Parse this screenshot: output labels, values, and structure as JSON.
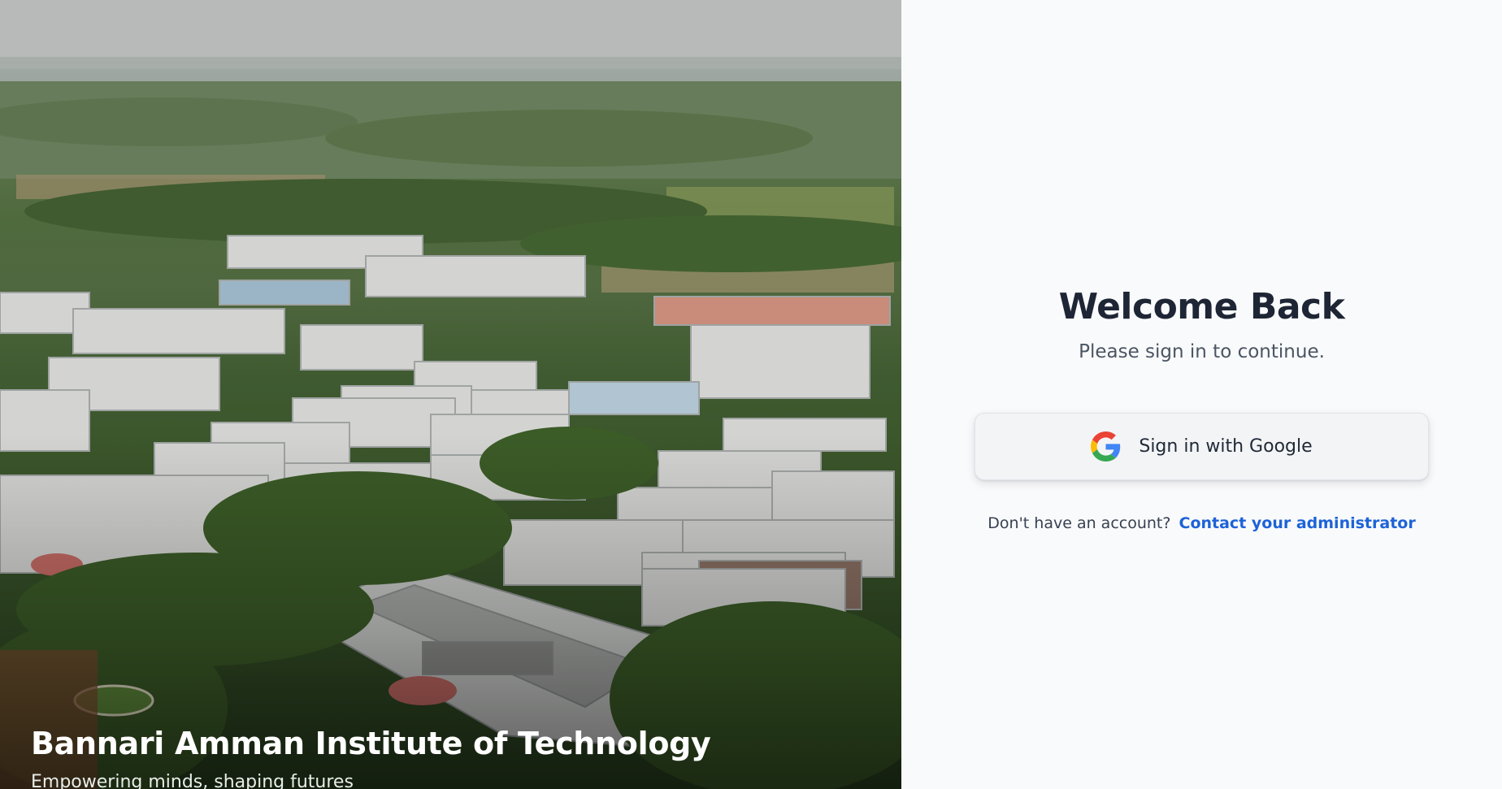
{
  "hero": {
    "title": "Bannari Amman Institute of Technology",
    "subtitle": "Empowering minds, shaping futures"
  },
  "login": {
    "heading": "Welcome Back",
    "subheading": "Please sign in to continue.",
    "google_button_label": "Sign in with Google",
    "google_icon": "google-g-icon",
    "no_account_text": "Don't have an account?",
    "contact_link_text": "Contact your administrator"
  },
  "colors": {
    "heading": "#1e2535",
    "link": "#1d63d8",
    "panel_bg": "#f9fafb",
    "button_bg": "#f3f4f6"
  }
}
